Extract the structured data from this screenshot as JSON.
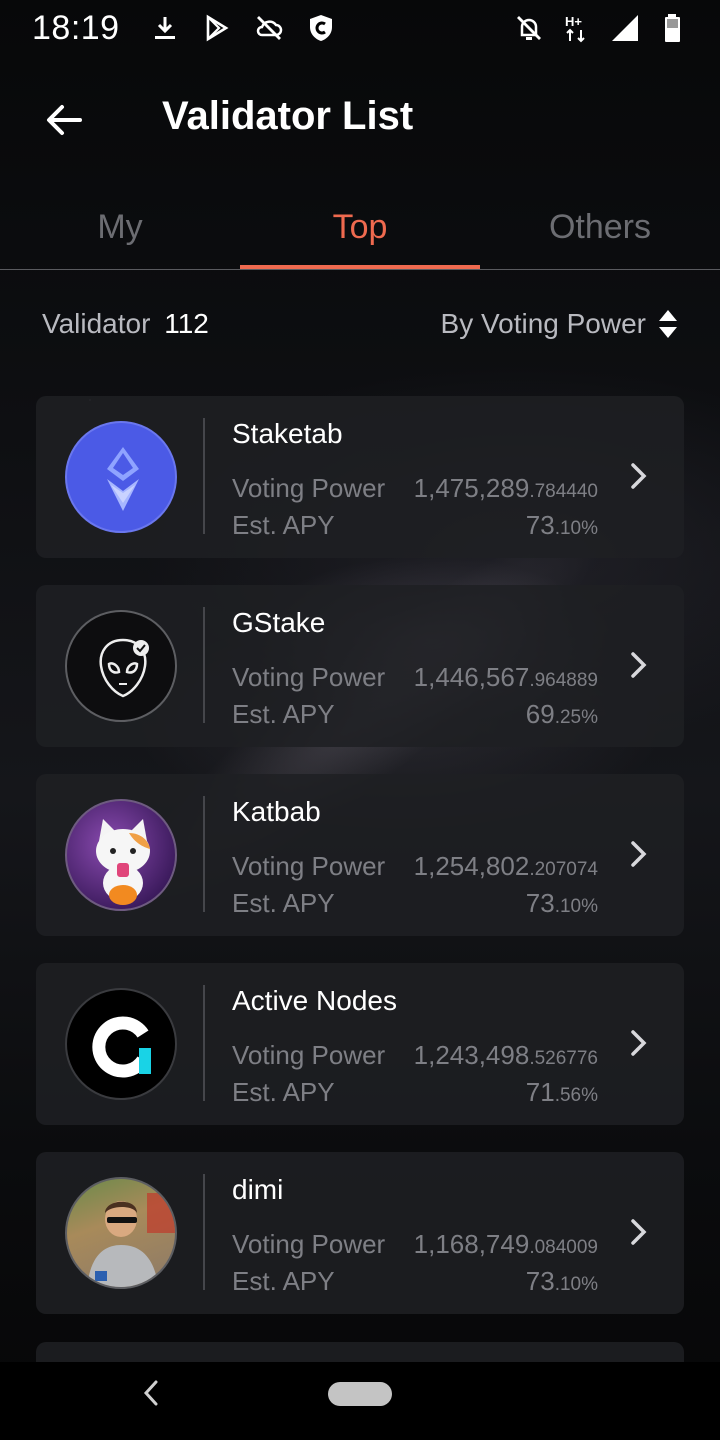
{
  "status_bar": {
    "time": "18:19",
    "left_icons": [
      "download-icon",
      "play-store-icon",
      "cloud-off-icon",
      "shield-c-icon"
    ],
    "right_icons": [
      "notifications-off-icon",
      "network-hplus-icon",
      "signal-icon",
      "battery-icon"
    ],
    "network_label": "H+"
  },
  "header": {
    "title": "Validator List"
  },
  "tabs": [
    {
      "label": "My",
      "active": false
    },
    {
      "label": "Top",
      "active": true
    },
    {
      "label": "Others",
      "active": false
    }
  ],
  "filter": {
    "count_label": "Validator",
    "count_value": "112",
    "sort_label": "By Voting Power"
  },
  "validators": [
    {
      "name": "Staketab",
      "vp_label": "Voting Power",
      "vp_int": "1,475,289",
      "vp_dec": ".784440",
      "apy_label": "Est. APY",
      "apy_int": "73",
      "apy_dec": ".10%",
      "avatar": "staketab-logo"
    },
    {
      "name": "GStake",
      "vp_label": "Voting Power",
      "vp_int": "1,446,567",
      "vp_dec": ".964889",
      "apy_label": "Est. APY",
      "apy_int": "69",
      "apy_dec": ".25%",
      "avatar": "gstake-logo"
    },
    {
      "name": "Katbab",
      "vp_label": "Voting Power",
      "vp_int": "1,254,802",
      "vp_dec": ".207074",
      "apy_label": "Est. APY",
      "apy_int": "73",
      "apy_dec": ".10%",
      "avatar": "katbab-logo"
    },
    {
      "name": "Active Nodes",
      "vp_label": "Voting Power",
      "vp_int": "1,243,498",
      "vp_dec": ".526776",
      "apy_label": "Est. APY",
      "apy_int": "71",
      "apy_dec": ".56%",
      "avatar": "active-nodes-logo"
    },
    {
      "name": "dimi",
      "vp_label": "Voting Power",
      "vp_int": "1,168,749",
      "vp_dec": ".084009",
      "apy_label": "Est. APY",
      "apy_int": "73",
      "apy_dec": ".10%",
      "avatar": "dimi-photo"
    }
  ],
  "colors": {
    "accent": "#ef6a4f",
    "card_bg": "#1e1f23",
    "muted_text": "#7e7f85"
  }
}
